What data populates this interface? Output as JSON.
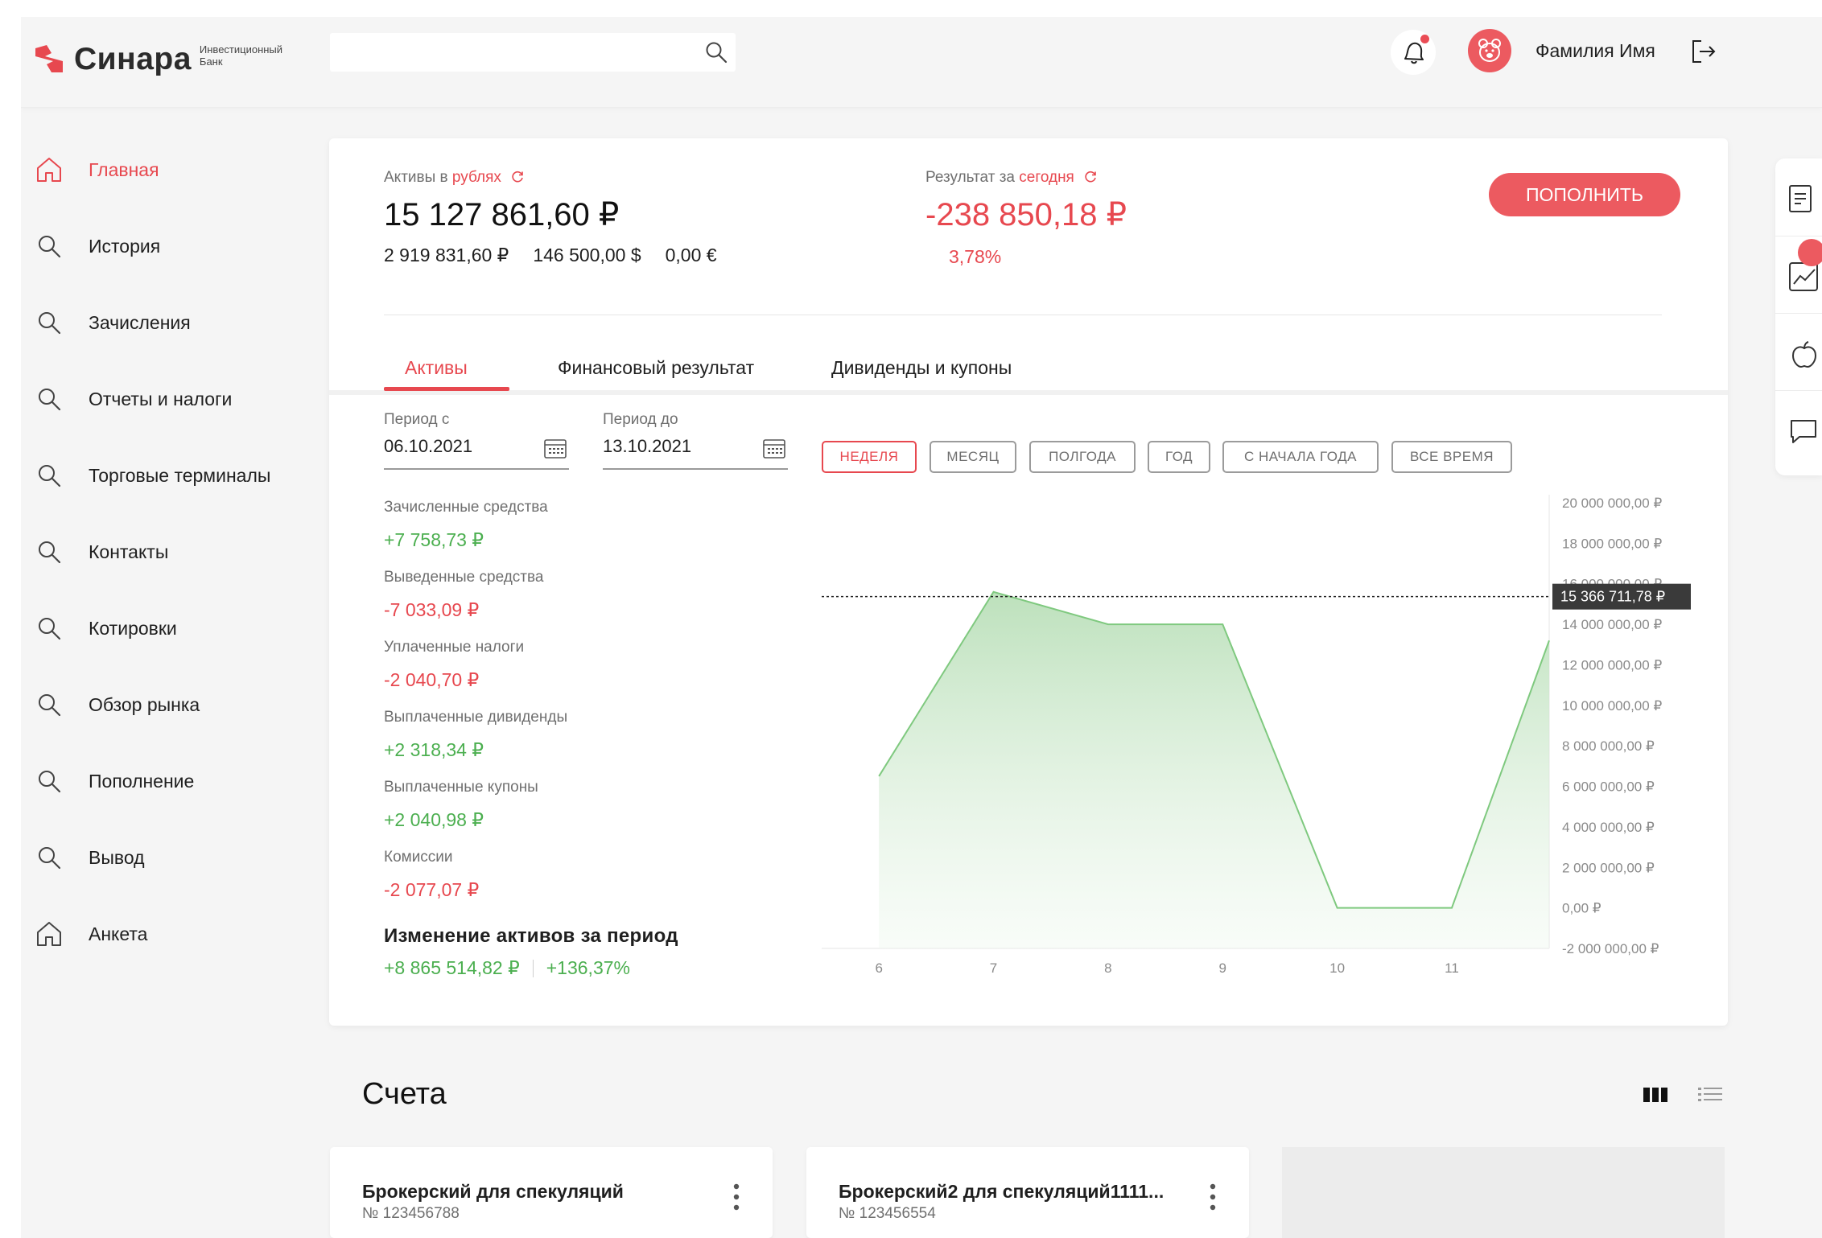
{
  "brand": {
    "name": "Синара",
    "subtitle_line1": "Инвестиционный",
    "subtitle_line2": "Банк",
    "color": "#e7484f"
  },
  "header": {
    "search_placeholder": "",
    "user_name": "Фамилия Имя",
    "has_notifications": true
  },
  "sidebar": {
    "items": [
      {
        "label": "Главная",
        "icon": "home-icon",
        "active": true
      },
      {
        "label": "История",
        "icon": "search-icon",
        "active": false
      },
      {
        "label": "Зачисления",
        "icon": "search-icon",
        "active": false
      },
      {
        "label": "Отчеты и налоги",
        "icon": "search-icon",
        "active": false
      },
      {
        "label": "Торговые терминалы",
        "icon": "search-icon",
        "active": false
      },
      {
        "label": "Контакты",
        "icon": "search-icon",
        "active": false
      },
      {
        "label": "Котировки",
        "icon": "search-icon",
        "active": false
      },
      {
        "label": "Обзор рынка",
        "icon": "search-icon",
        "active": false
      },
      {
        "label": "Пополнение",
        "icon": "search-icon",
        "active": false
      },
      {
        "label": "Вывод",
        "icon": "search-icon",
        "active": false
      },
      {
        "label": "Анкета",
        "icon": "home-icon",
        "active": false
      }
    ]
  },
  "summary": {
    "assets_label": "Активы в",
    "assets_currency_link": "рублях",
    "assets_total": "15 127 861,60 ₽",
    "assets_rub": "2 919 831,60 ₽",
    "assets_usd": "146 500,00 $",
    "assets_eur": "0,00 €",
    "result_label": "Результат за",
    "result_period_link": "сегодня",
    "result_total": "-238 850,18 ₽",
    "result_pct": "3,78%",
    "topup_button": "ПОПОЛНИТЬ"
  },
  "tabs": [
    {
      "label": "Активы",
      "active": true
    },
    {
      "label": "Финансовый результат",
      "active": false
    },
    {
      "label": "Дивиденды и купоны",
      "active": false
    }
  ],
  "period": {
    "from_label": "Период с",
    "from_value": "06.10.2021",
    "to_label": "Период до",
    "to_value": "13.10.2021"
  },
  "ranges": [
    {
      "label": "НЕДЕЛЯ",
      "active": true
    },
    {
      "label": "МЕСЯЦ",
      "active": false
    },
    {
      "label": "ПОЛГОДА",
      "active": false
    },
    {
      "label": "ГОД",
      "active": false
    },
    {
      "label": "С НАЧАЛА ГОДА",
      "active": false
    },
    {
      "label": "ВСЕ ВРЕМЯ",
      "active": false
    }
  ],
  "stats": [
    {
      "label": "Зачисленные средства",
      "value": "+7 758,73 ₽",
      "tone": "positive"
    },
    {
      "label": "Выведенные средства",
      "value": "-7 033,09 ₽",
      "tone": "negative"
    },
    {
      "label": "Уплаченные налоги",
      "value": "-2 040,70 ₽",
      "tone": "negative"
    },
    {
      "label": "Выплаченные дивиденды",
      "value": "+2 318,34 ₽",
      "tone": "positive"
    },
    {
      "label": "Выплаченные купоны",
      "value": "+2 040,98 ₽",
      "tone": "positive"
    },
    {
      "label": "Комиссии",
      "value": "-2 077,07 ₽",
      "tone": "negative"
    }
  ],
  "change": {
    "label": "Изменение активов за период",
    "amount": "+8 865 514,82 ₽",
    "percent": "+136,37%"
  },
  "chart_data": {
    "type": "area",
    "x": [
      6,
      7,
      8,
      9,
      10,
      11,
      11.85
    ],
    "y": [
      6500000,
      15600000,
      14000000,
      14000000,
      0,
      0,
      13200000
    ],
    "xticks": [
      "6",
      "7",
      "8",
      "9",
      "10",
      "11"
    ],
    "ylim": [
      -2000000,
      20000000
    ],
    "yticks": [
      "20 000 000,00 ₽",
      "18 000 000,00 ₽",
      "16 000 000,00 ₽",
      "14 000 000,00 ₽",
      "12 000 000,00 ₽",
      "10 000 000,00 ₽",
      "8 000 000,00 ₽",
      "6 000 000,00 ₽",
      "4 000 000,00 ₽",
      "2 000 000,00 ₽",
      "0,00 ₽",
      "-2 000 000,00 ₽"
    ],
    "ytick_values": [
      20000000,
      18000000,
      16000000,
      14000000,
      12000000,
      10000000,
      8000000,
      6000000,
      4000000,
      2000000,
      0,
      -2000000
    ],
    "reference_value": 15366711.78,
    "reference_label": "15 366 711,78 ₽",
    "color": "#7fc97f",
    "grid": false
  },
  "accounts": {
    "title": "Счета",
    "items": [
      {
        "name": "Брокерский для спекуляций",
        "number": "№ 123456788"
      },
      {
        "name": "Брокерский2 для спекуляций1111...",
        "number": "№ 123456554"
      }
    ]
  },
  "right_rail": {
    "items": [
      "document-list-icon",
      "chart-line-icon",
      "apple-icon",
      "chat-icon"
    ]
  }
}
